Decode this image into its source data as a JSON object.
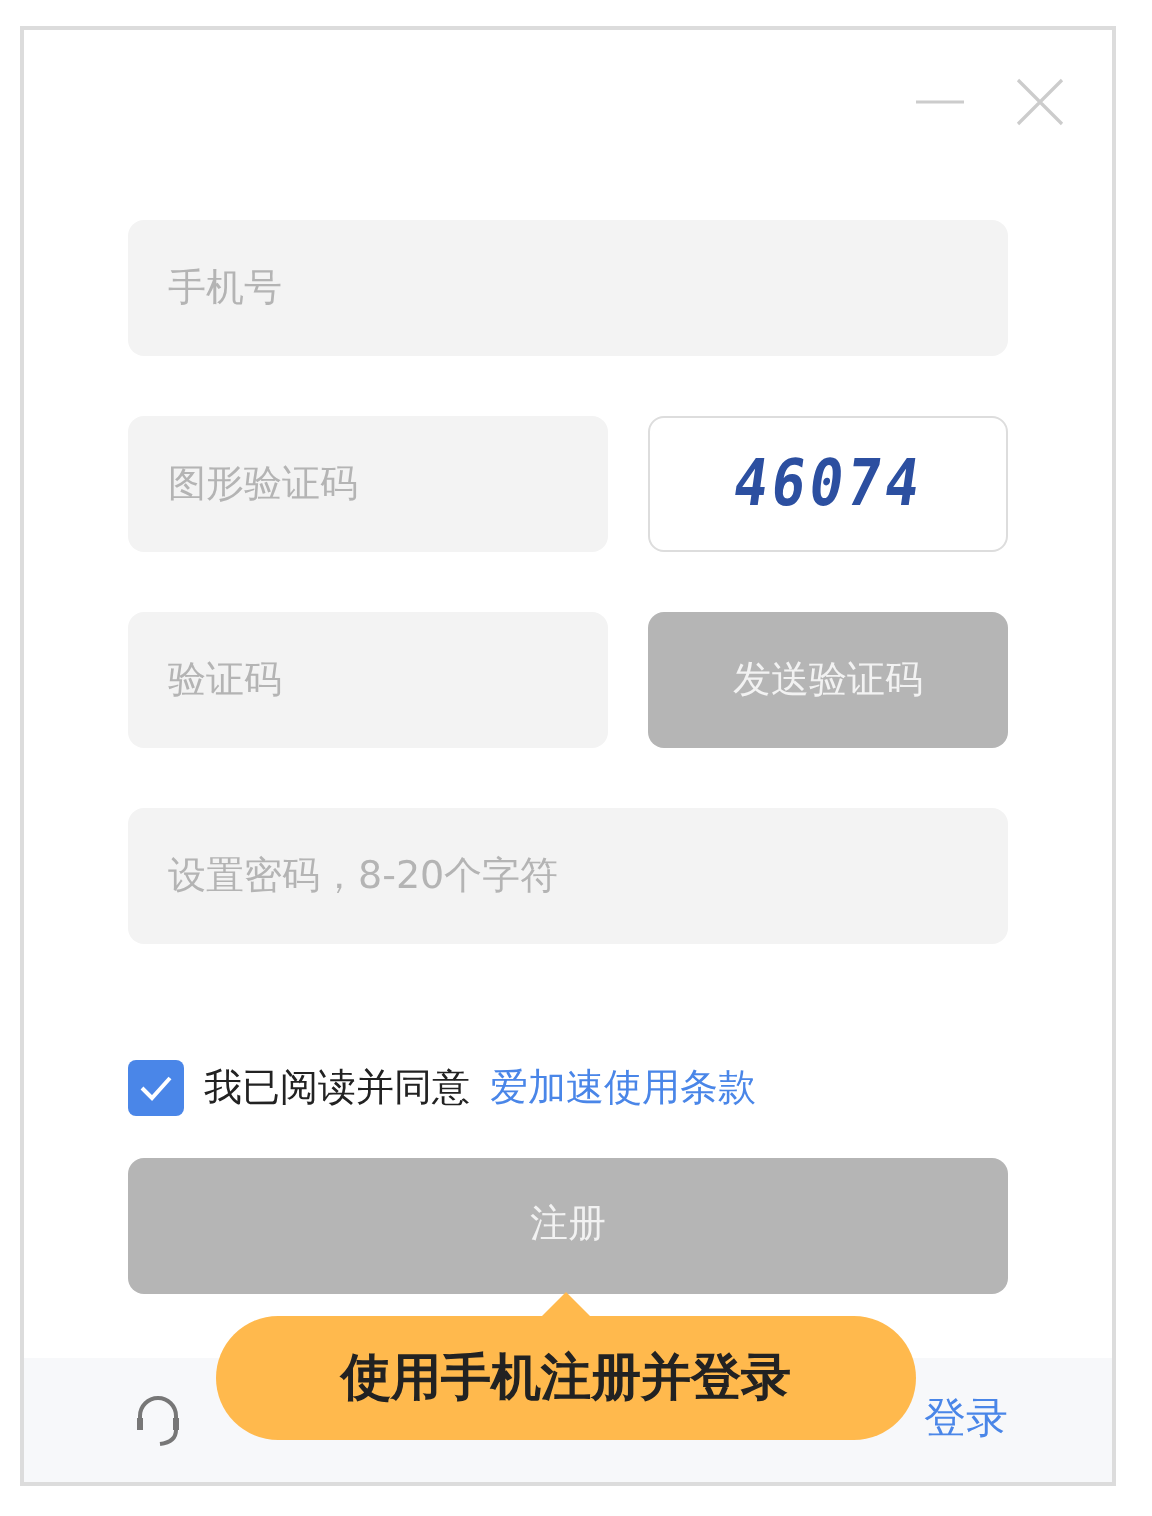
{
  "fields": [
    {
      "kind": "full",
      "placeholder": "手机号"
    },
    {
      "kind": "captcha",
      "placeholder": "图形验证码",
      "captcha": "46074"
    },
    {
      "kind": "sms",
      "placeholder": "验证码",
      "button": "发送验证码",
      "disabled": true
    },
    {
      "kind": "full",
      "placeholder": "设置密码，8-20个字符"
    }
  ],
  "agreement": {
    "checked": true,
    "text": "我已阅读并同意",
    "link": "爱加速使用条款"
  },
  "submit": {
    "label": "注册",
    "disabled": true
  },
  "tooltip": "使用手机注册并登录",
  "footer": {
    "link": "登录"
  }
}
